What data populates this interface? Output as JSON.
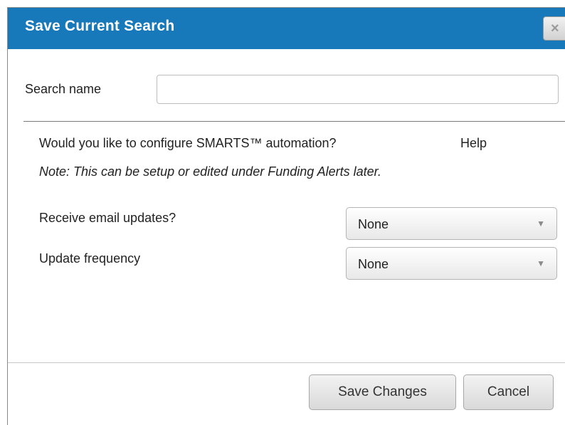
{
  "dialog": {
    "title": "Save Current Search",
    "close_label": "×"
  },
  "search": {
    "label": "Search name",
    "value": "",
    "placeholder": ""
  },
  "automation": {
    "question": "Would you like to configure SMARTS™ automation?",
    "help_label": "Help",
    "note": "Note: This can be setup or edited under Funding Alerts later."
  },
  "email_updates": {
    "label": "Receive email updates?",
    "selected": "None",
    "arrow": "▼"
  },
  "update_frequency": {
    "label": "Update frequency",
    "selected": "None",
    "arrow": "▼"
  },
  "footer": {
    "save_label": "Save Changes",
    "cancel_label": "Cancel"
  },
  "colors": {
    "titlebar": "#1778ba",
    "title_text": "#ffffff",
    "button_bg": "#e4e4e4"
  },
  "icons": {
    "close": "close-icon",
    "dropdown": "chevron-down-icon"
  }
}
